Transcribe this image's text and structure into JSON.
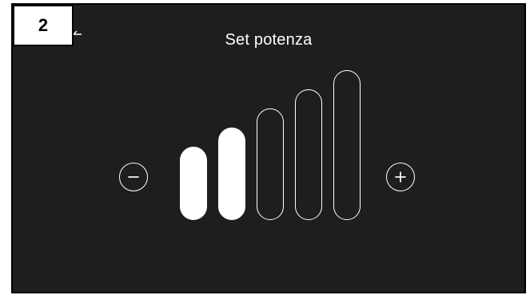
{
  "step_badge": {
    "label": "2"
  },
  "screen": {
    "title": "Set potenza",
    "background_color": "#1e1e1e",
    "foreground_color": "#ffffff"
  },
  "controls": {
    "minus_icon": "minus-circle-icon",
    "plus_icon": "plus-circle-icon",
    "back_icon": "back-arrow-icon"
  },
  "power": {
    "level": 2,
    "max_level": 5
  }
}
